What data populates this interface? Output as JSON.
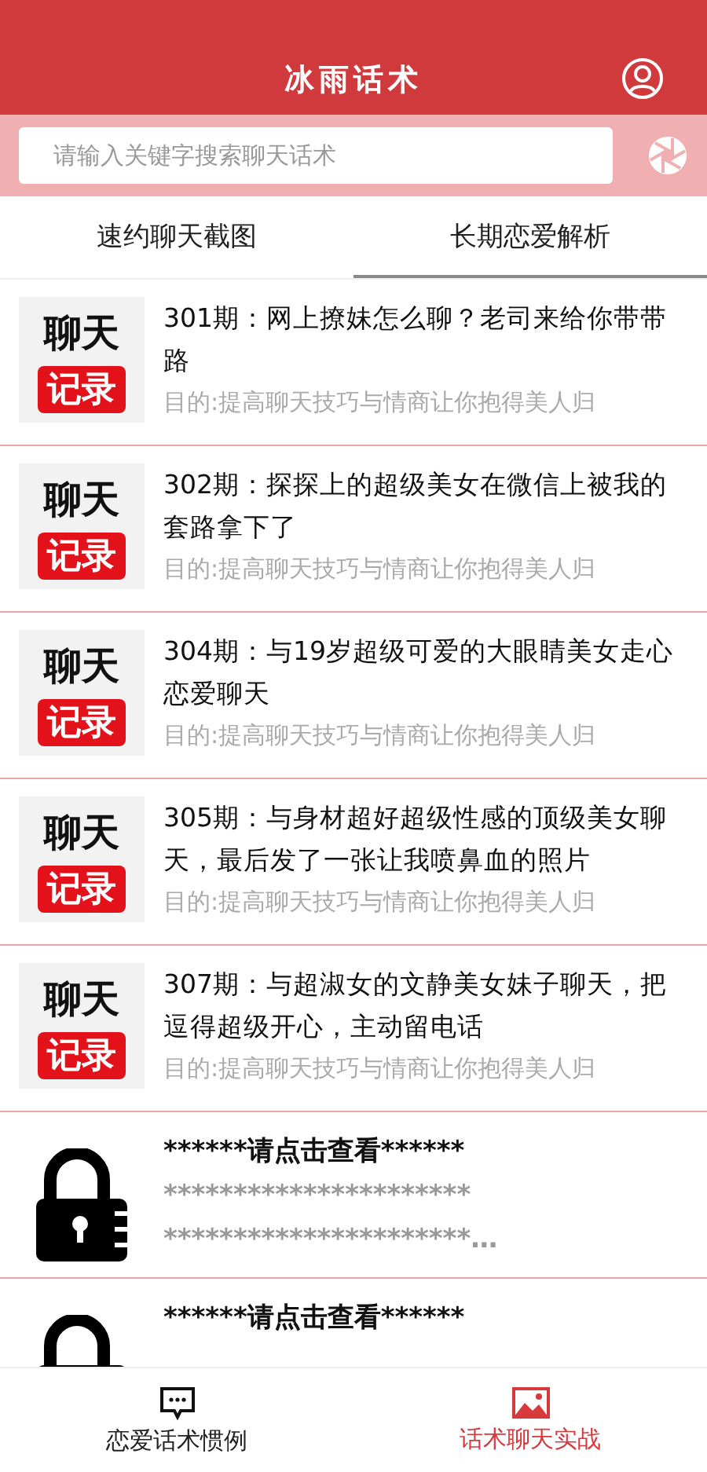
{
  "header": {
    "title": "冰雨话术"
  },
  "search": {
    "placeholder": "请输入关键字搜索聊天话术"
  },
  "tabs": [
    {
      "label": "速约聊天截图",
      "selected": false
    },
    {
      "label": "长期恋爱解析",
      "selected": true
    }
  ],
  "items": [
    {
      "kind": "article",
      "thumb": [
        "聊天",
        "记录"
      ],
      "title": "301期：网上撩妹怎么聊？老司来给你带带路",
      "subtitle": "目的:提高聊天技巧与情商让你抱得美人归"
    },
    {
      "kind": "article",
      "thumb": [
        "聊天",
        "记录"
      ],
      "title": "302期：探探上的超级美女在微信上被我的套路拿下了",
      "subtitle": "目的:提高聊天技巧与情商让你抱得美人归"
    },
    {
      "kind": "article",
      "thumb": [
        "聊天",
        "记录"
      ],
      "title": "304期：与19岁超级可爱的大眼睛美女走心恋爱聊天",
      "subtitle": "目的:提高聊天技巧与情商让你抱得美人归"
    },
    {
      "kind": "article",
      "thumb": [
        "聊天",
        "记录"
      ],
      "title": "305期：与身材超好超级性感的顶级美女聊天，最后发了一张让我喷鼻血的照片",
      "subtitle": "目的:提高聊天技巧与情商让你抱得美人归"
    },
    {
      "kind": "article",
      "thumb": [
        "聊天",
        "记录"
      ],
      "title": "307期：与超淑女的文静美女妹子聊天，把逗得超级开心，主动留电话",
      "subtitle": "目的:提高聊天技巧与情商让你抱得美人归"
    },
    {
      "kind": "locked",
      "title": "******请点击查看******",
      "lines": [
        "**********************",
        "**********************…"
      ]
    },
    {
      "kind": "locked",
      "title": "******请点击查看******"
    }
  ],
  "bottom_nav": [
    {
      "label": "恋爱话术惯例",
      "kind": "chat",
      "selected": false
    },
    {
      "label": "话术聊天实战",
      "kind": "image",
      "selected": true
    }
  ]
}
